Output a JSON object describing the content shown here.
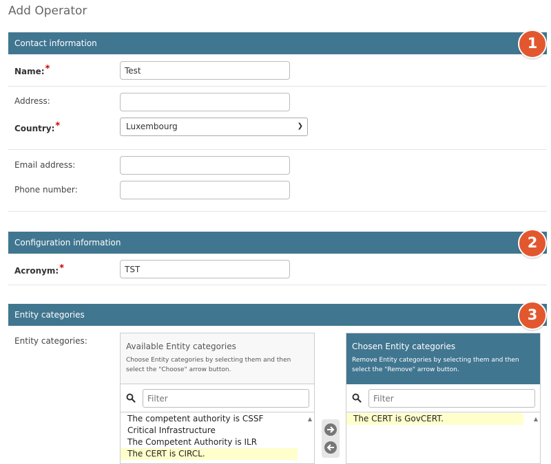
{
  "page": {
    "title": "Add Operator"
  },
  "colors": {
    "section_bar": "#417690",
    "step_badge": "#e3572f",
    "required_star": "#cc0000",
    "selected_item": "#ffffcc"
  },
  "contact_section": {
    "title": "Contact information",
    "step": "1",
    "name_label": "Name:",
    "name_value": "Test",
    "address_label": "Address:",
    "address_value": "",
    "country_label": "Country:",
    "country_value": "Luxembourg",
    "email_label": "Email address:",
    "email_value": "",
    "phone_label": "Phone number:",
    "phone_value": ""
  },
  "config_section": {
    "title": "Configuration information",
    "step": "2",
    "acronym_label": "Acronym:",
    "acronym_value": "TST"
  },
  "entity_section": {
    "title": "Entity categories",
    "step": "3",
    "field_label": "Entity categories:",
    "available": {
      "title": "Available Entity categories",
      "help": "Choose Entity categories by selecting them and then select the \"Choose\" arrow button.",
      "filter_placeholder": "Filter",
      "items": [
        {
          "label": "The competent authority is CSSF",
          "selected": false
        },
        {
          "label": "Critical Infrastructure",
          "selected": false
        },
        {
          "label": "The Competent Authority is ILR",
          "selected": false
        },
        {
          "label": "The CERT is CIRCL.",
          "selected": true
        }
      ]
    },
    "chosen": {
      "title": "Chosen Entity categories",
      "help": "Remove Entity categories by selecting them and then select the \"Remove\" arrow button.",
      "filter_placeholder": "Filter",
      "items": [
        {
          "label": "The CERT is GovCERT.",
          "selected": true
        }
      ]
    },
    "choose_icon": "arrow-right-circle-icon",
    "remove_icon": "arrow-left-circle-icon"
  }
}
